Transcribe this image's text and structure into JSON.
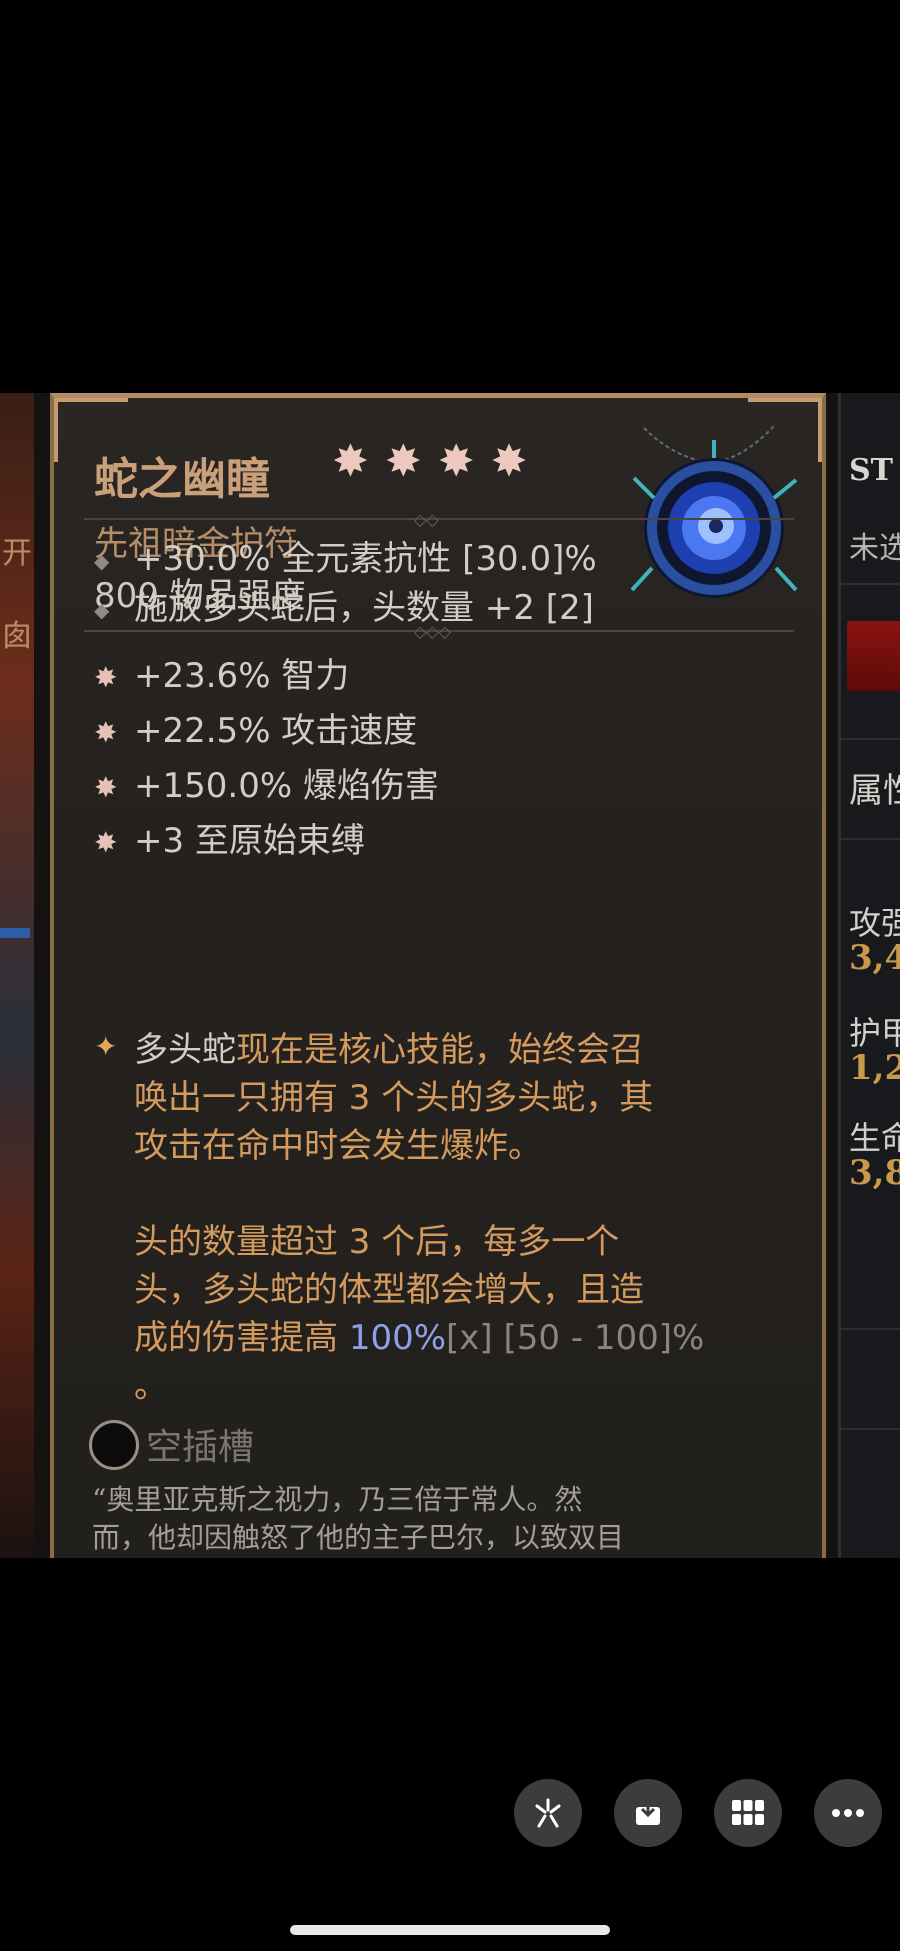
{
  "item": {
    "name": "蛇之幽瞳",
    "stars": "✸✸✸✸",
    "type": "先祖暗金护符",
    "power": "800 物品强度",
    "implicit": [
      "+30.0% 全元素抗性 [30.0]%",
      "施放多头蛇后，头数量 +2 [2]"
    ],
    "affixes": [
      "+23.6% 智力",
      "+22.5% 攻击速度",
      "+150.0% 爆焰伤害",
      "+3 至原始束缚"
    ],
    "legendary": {
      "line1_a": "多头蛇",
      "line1_b": "现在是核心技能，始终会召",
      "line2": "唤出一只拥有 3 个头的多头蛇，其",
      "line3": "攻击在命中时会发生爆炸。",
      "line4": "头的数量超过 3 个后，每多一个",
      "line5": "头，多头蛇的体型都会增大，且造",
      "line6_a": "成的伤害提高 ",
      "line6_b": "100%",
      "line6_c": "[x]",
      "line6_d": " [50 - 100]%",
      "line7": "。"
    },
    "socket": "空插槽",
    "flavor_1": "“奥里亚克斯之视力，乃三倍于常人。然",
    "flavor_2": "而，他却因触怒了他的主子巴尔，以致双目"
  },
  "right_panel": {
    "st": "ST",
    "unselected": "未选",
    "attributes": "属性",
    "attack_label": "攻强",
    "attack_value": "3,4",
    "armor_label": "护甲",
    "armor_value": "1,2",
    "life_label": "生命",
    "life_value": "3,8"
  },
  "left_edge": {
    "frag1": "开",
    "frag2": "囱"
  },
  "colors": {
    "legendary_text": "#d49a5e",
    "title": "#c9a07a",
    "highlight_value": "#8fa0ea"
  },
  "toolbar_icons": [
    "edit-icon",
    "save-icon",
    "grid-icon",
    "more-icon"
  ]
}
